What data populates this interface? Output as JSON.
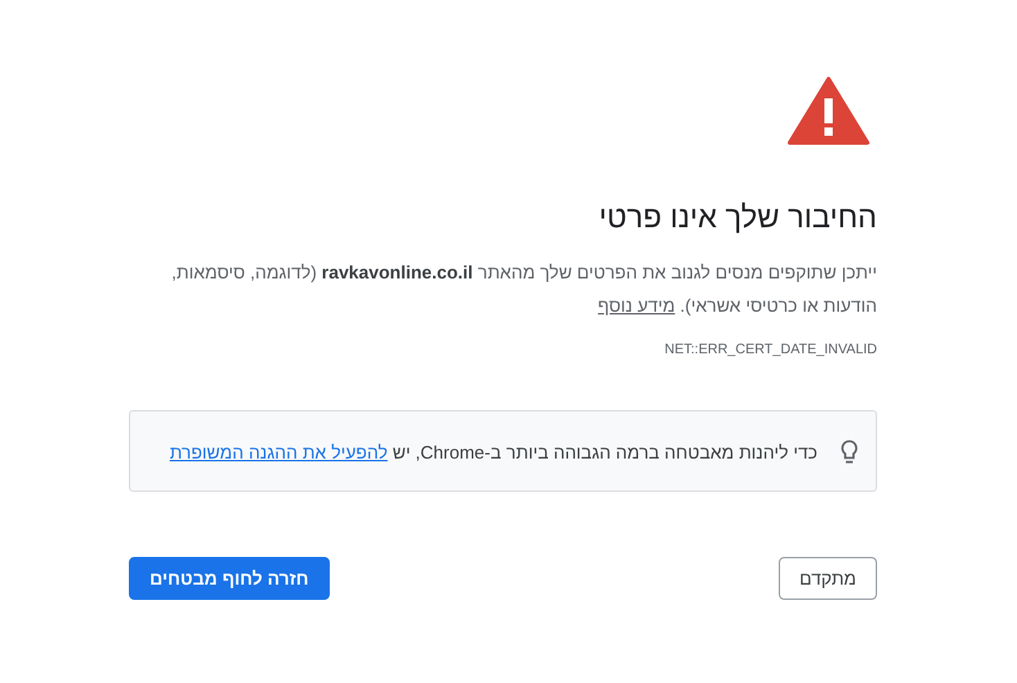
{
  "heading": "החיבור שלך אינו פרטי",
  "description": {
    "text": "ייתכן שתוקפים מנסים לגנוב את הפרטים שלך מהאתר **ravkavonline.co.il** (לדוגמה, סיסמאות, הודעות או כרטיסי אשראי).",
    "link": "מידע נוסף"
  },
  "error_code": "NET::ERR_CERT_DATE_INVALID",
  "hint": {
    "text": "כדי ליהנות מאבטחה ברמה הגבוהה ביותר ב-Chrome, יש",
    "link": "להפעיל את ההגנה המשופרת"
  },
  "buttons": [
    {
      "label": "מתקדם",
      "kind": "secondary"
    },
    {
      "label": "חזרה לחוף מבטחים",
      "kind": "primary"
    }
  ]
}
